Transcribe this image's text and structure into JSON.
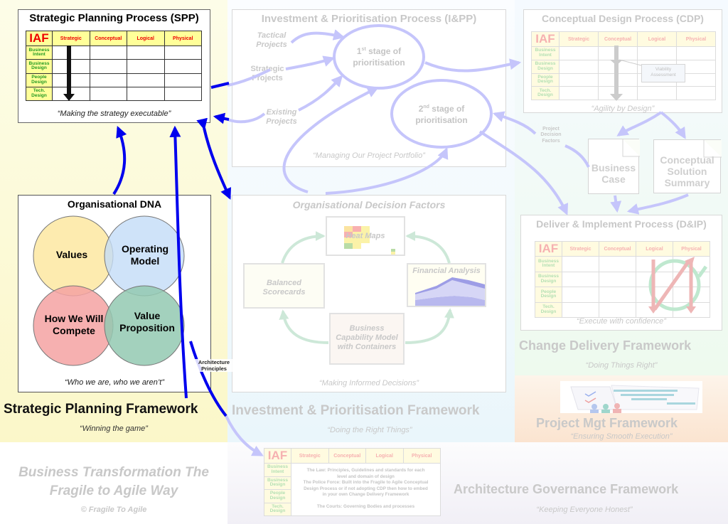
{
  "iaf": {
    "corner": "IAF",
    "columns": [
      "Strategic",
      "Conceptual",
      "Logical",
      "Physical"
    ],
    "rows": [
      [
        "Business",
        "Intent"
      ],
      [
        "Business",
        "Design"
      ],
      [
        "People",
        "Design"
      ],
      [
        "Tech.",
        "Design"
      ]
    ]
  },
  "spp": {
    "title": "Strategic Planning Process (SPP)",
    "quote": "“Making the strategy executable”"
  },
  "org_dna": {
    "title": "Organisational DNA",
    "circles": [
      {
        "label_1": "Values",
        "label_2": "",
        "color": "#fde9a6"
      },
      {
        "label_1": "Operating",
        "label_2": "Model",
        "color": "#c3dcf7"
      },
      {
        "label_1": "How We Will",
        "label_2": "Compete",
        "color": "#f5a2a2"
      },
      {
        "label_1": "Value",
        "label_2": "Proposition",
        "color": "#93c9b2"
      }
    ],
    "quote": "“Who we are, who we aren’t”"
  },
  "spf": {
    "title": "Strategic Planning Framework",
    "quote": "“Winning the game”"
  },
  "architecture_principles": {
    "line_1": "Architecture",
    "line_2": "Principles"
  },
  "ipp": {
    "title": "Investment & Prioritisation Process (I&PP)",
    "inputs": [
      {
        "line_1": "Tactical",
        "line_2": "Projects"
      },
      {
        "line_1": "Strategic",
        "line_2": "Projects"
      },
      {
        "line_1": "Existing",
        "line_2": "Projects"
      }
    ],
    "stage_1": {
      "num": "1",
      "sup": "st",
      "rest": " stage of",
      "line_2": "prioritisation"
    },
    "stage_2": {
      "num": "2",
      "sup": "nd",
      "rest": " stage of",
      "line_2": "prioritisation"
    },
    "quote": "“Managing Our Project Portfolio”"
  },
  "odf": {
    "title": "Organisational Decision Factors",
    "items": {
      "heat_maps": "Heat Maps",
      "balanced_scorecards": [
        "Balanced",
        "Scorecards"
      ],
      "financial_analysis": "Financial Analysis",
      "capability_model": [
        "Business",
        "Capability Model",
        "with Containers"
      ]
    },
    "quote": "“Making Informed Decisions”"
  },
  "ipf": {
    "title": "Investment & Prioritisation Framework",
    "quote": "“Doing the Right Things”"
  },
  "cdp": {
    "title": "Conceptual Design Process (CDP)",
    "viability": [
      "Viability",
      "Assessment"
    ],
    "quote": "“Agility by Design”"
  },
  "project_decision_factors": [
    "Project",
    "Decision",
    "Factors"
  ],
  "documents": {
    "business_case": [
      "Business",
      "Case"
    ],
    "conceptual_solution_summary": [
      "Conceptual",
      "Solution",
      "Summary"
    ]
  },
  "dip": {
    "title": "Deliver & Implement Process (D&IP)",
    "quote": "“Execute with confidence”"
  },
  "cdf": {
    "title": "Change Delivery Framework",
    "quote": "“Doing Things Right”"
  },
  "pmf": {
    "title": "Project Mgt Framework",
    "quote": "“Ensuring Smooth Execution”"
  },
  "governance": {
    "law": [
      "The Law: Principles, Guidelines and standards for each",
      "level and domain of design"
    ],
    "police": [
      "The Police Force: Built into the Fragile to Agile Conceptual",
      "Design Process or if not adopting CDP then how to embed",
      "in your own Change Delivery Framework"
    ],
    "courts": "The Courts: Governing Bodies and processes"
  },
  "agf": {
    "title": "Architecture Governance Framework",
    "quote": "“Keeping Everyone Honest”"
  },
  "footer": {
    "title_1": "Business Transformation The",
    "title_2": "Fragile to Agile Way",
    "copyright": "© Fragile To Agile"
  },
  "colors": {
    "strong_arrow": "#0000ee",
    "faded_arrow": "#c5c5fb",
    "odf_arrow": "#cde8d8",
    "faded_text": "#c8c8c8"
  }
}
